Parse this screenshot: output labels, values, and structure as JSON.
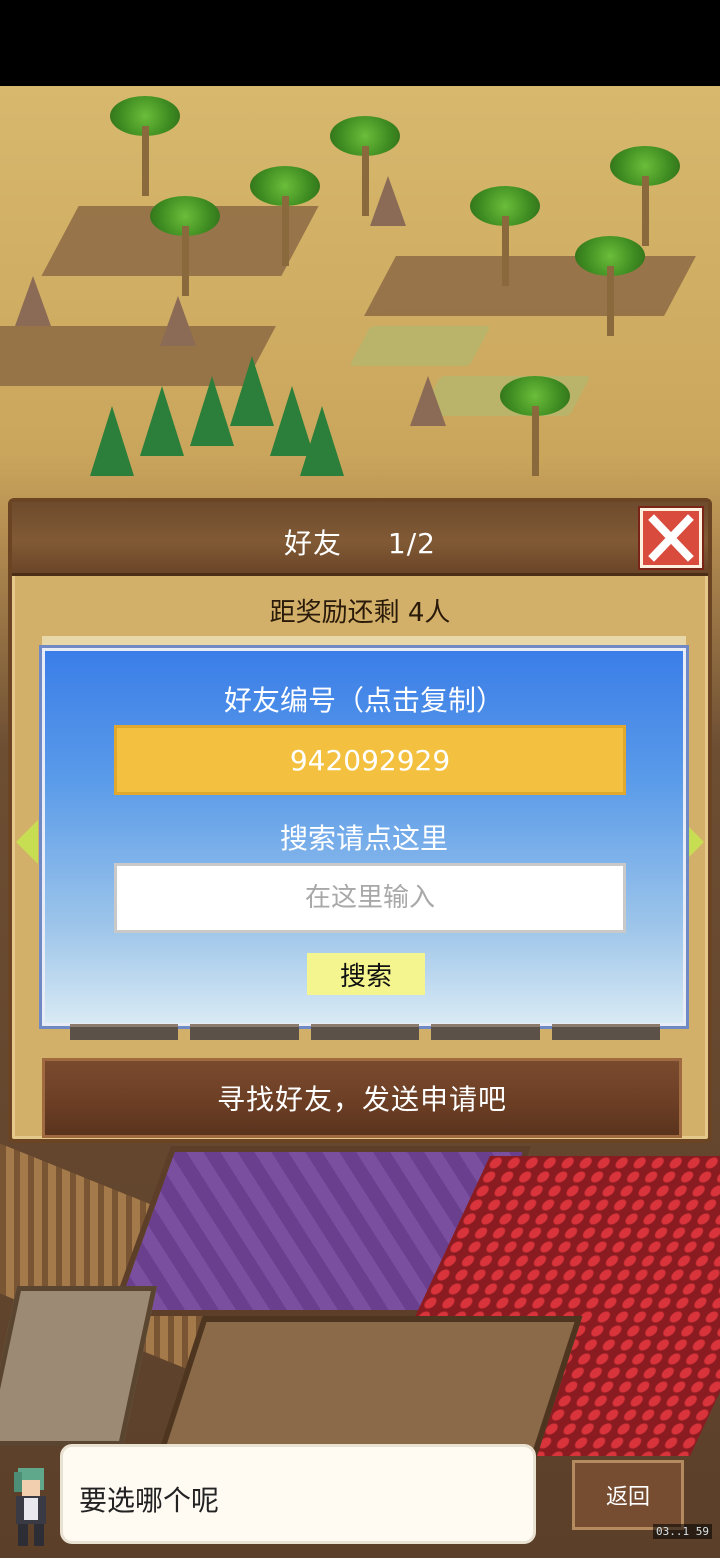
{
  "dialog": {
    "title": "好友",
    "page": "1/2",
    "reward_text": "距奖励还剩 4人",
    "close_icon": "close-icon"
  },
  "friend_panel": {
    "id_label": "好友编号（点击复制）",
    "friend_id": "942092929",
    "search_label": "搜索请点这里",
    "search_placeholder": "在这里输入",
    "search_value": "",
    "search_button": "搜索"
  },
  "find_friend_button": "寻找好友，发送申请吧",
  "speech": {
    "text": "要选哪个呢",
    "back_label": "返回",
    "hud_tag": "03..1 59"
  },
  "colors": {
    "id_box": "#f3c13f",
    "panel_blue": "#3b7ee8",
    "close_red": "#d94b3c",
    "search_button": "#f4f58f",
    "nav_arrow": "#c8de52"
  }
}
